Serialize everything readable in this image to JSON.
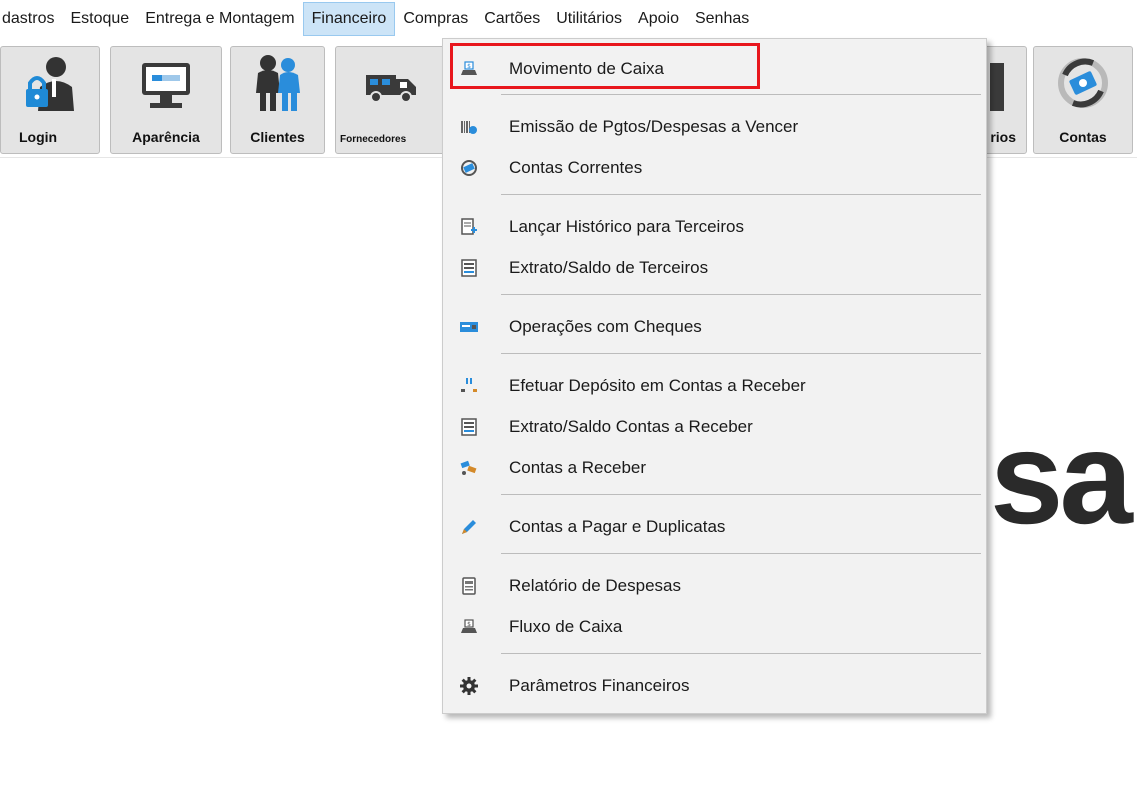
{
  "menubar": {
    "items": [
      {
        "label": "dastros",
        "name": "menu-cadastros"
      },
      {
        "label": "Estoque",
        "name": "menu-estoque"
      },
      {
        "label": "Entrega e Montagem",
        "name": "menu-entrega-montagem"
      },
      {
        "label": "Financeiro",
        "name": "menu-financeiro"
      },
      {
        "label": "Compras",
        "name": "menu-compras"
      },
      {
        "label": "Cartões",
        "name": "menu-cartoes"
      },
      {
        "label": "Utilitários",
        "name": "menu-utilitarios"
      },
      {
        "label": "Apoio",
        "name": "menu-apoio"
      },
      {
        "label": "Senhas",
        "name": "menu-senhas"
      }
    ],
    "active": "Financeiro"
  },
  "toolbar": {
    "login": "Login",
    "aparencia": "Aparência",
    "clientes": "Clientes",
    "fornecedores": "Fornecedores",
    "relatorios_partial": "rios",
    "contas": "Contas"
  },
  "background_text": "sa",
  "financeiro_menu": {
    "movimento_caixa": "Movimento de Caixa",
    "emissao_pgtos": "Emissão de Pgtos/Despesas a Vencer",
    "contas_correntes": "Contas Correntes",
    "lancar_historico": "Lançar Histórico para Terceiros",
    "extrato_terceiros": "Extrato/Saldo de Terceiros",
    "operacoes_cheques": "Operações com Cheques",
    "efetuar_deposito": "Efetuar Depósito em Contas a Receber",
    "extrato_receber": "Extrato/Saldo Contas a Receber",
    "contas_receber": "Contas a Receber",
    "contas_pagar": "Contas a Pagar e Duplicatas",
    "relatorio_despesas": "Relatório de Despesas",
    "fluxo_caixa": "Fluxo de Caixa",
    "parametros": "Parâmetros Financeiros"
  },
  "colors": {
    "highlight": "#e8161d",
    "menu_active": "#cce4f7",
    "menu_bg": "#f2f2f2"
  }
}
